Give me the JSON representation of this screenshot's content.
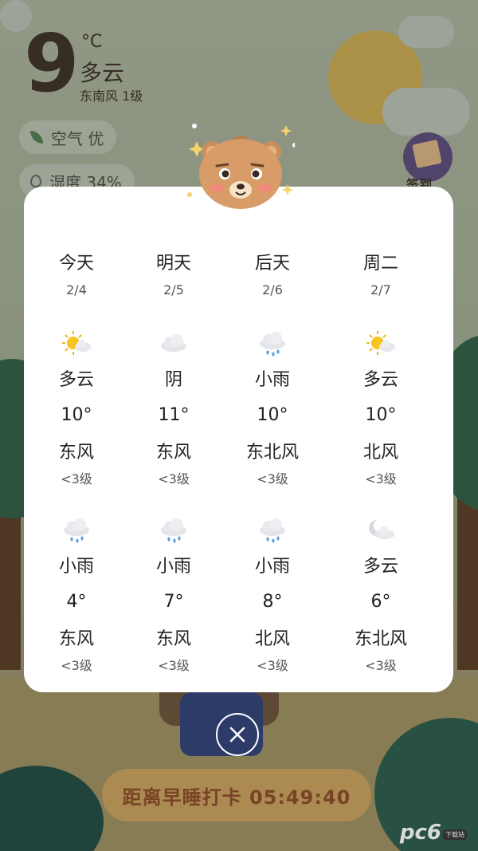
{
  "current": {
    "temperature": "9",
    "unit": "°C",
    "condition": "多云",
    "wind": "东南风 1级",
    "air_label": "空气 优",
    "humidity_label": "湿度 34%"
  },
  "checkin_badge_label": "签到",
  "countdown_text": "距离早睡打卡 05:49:40",
  "watermark": {
    "text": "pc6",
    "sub": "下载站"
  },
  "forecast": {
    "days": [
      {
        "name": "今天",
        "date": "2/4"
      },
      {
        "name": "明天",
        "date": "2/5"
      },
      {
        "name": "后天",
        "date": "2/6"
      },
      {
        "name": "周二",
        "date": "2/7"
      }
    ],
    "day_rows": [
      {
        "icon": "sun-cloud-icon",
        "condition": "多云",
        "temp": "10°",
        "wind_dir": "东风",
        "wind_level": "<3级"
      },
      {
        "icon": "cloud-icon",
        "condition": "阴",
        "temp": "11°",
        "wind_dir": "东风",
        "wind_level": "<3级"
      },
      {
        "icon": "rain-icon",
        "condition": "小雨",
        "temp": "10°",
        "wind_dir": "东北风",
        "wind_level": "<3级"
      },
      {
        "icon": "sun-cloud-icon",
        "condition": "多云",
        "temp": "10°",
        "wind_dir": "北风",
        "wind_level": "<3级"
      }
    ],
    "night_rows": [
      {
        "icon": "rain-icon",
        "condition": "小雨",
        "temp": "4°",
        "wind_dir": "东风",
        "wind_level": "<3级"
      },
      {
        "icon": "rain-icon",
        "condition": "小雨",
        "temp": "7°",
        "wind_dir": "东风",
        "wind_level": "<3级"
      },
      {
        "icon": "rain-icon",
        "condition": "小雨",
        "temp": "8°",
        "wind_dir": "北风",
        "wind_level": "<3级"
      },
      {
        "icon": "moon-cloud-icon",
        "condition": "多云",
        "temp": "6°",
        "wind_dir": "东北风",
        "wind_level": "<3级"
      }
    ]
  },
  "icons": {
    "close": "close-icon",
    "mascot": "bear-mascot-icon"
  }
}
